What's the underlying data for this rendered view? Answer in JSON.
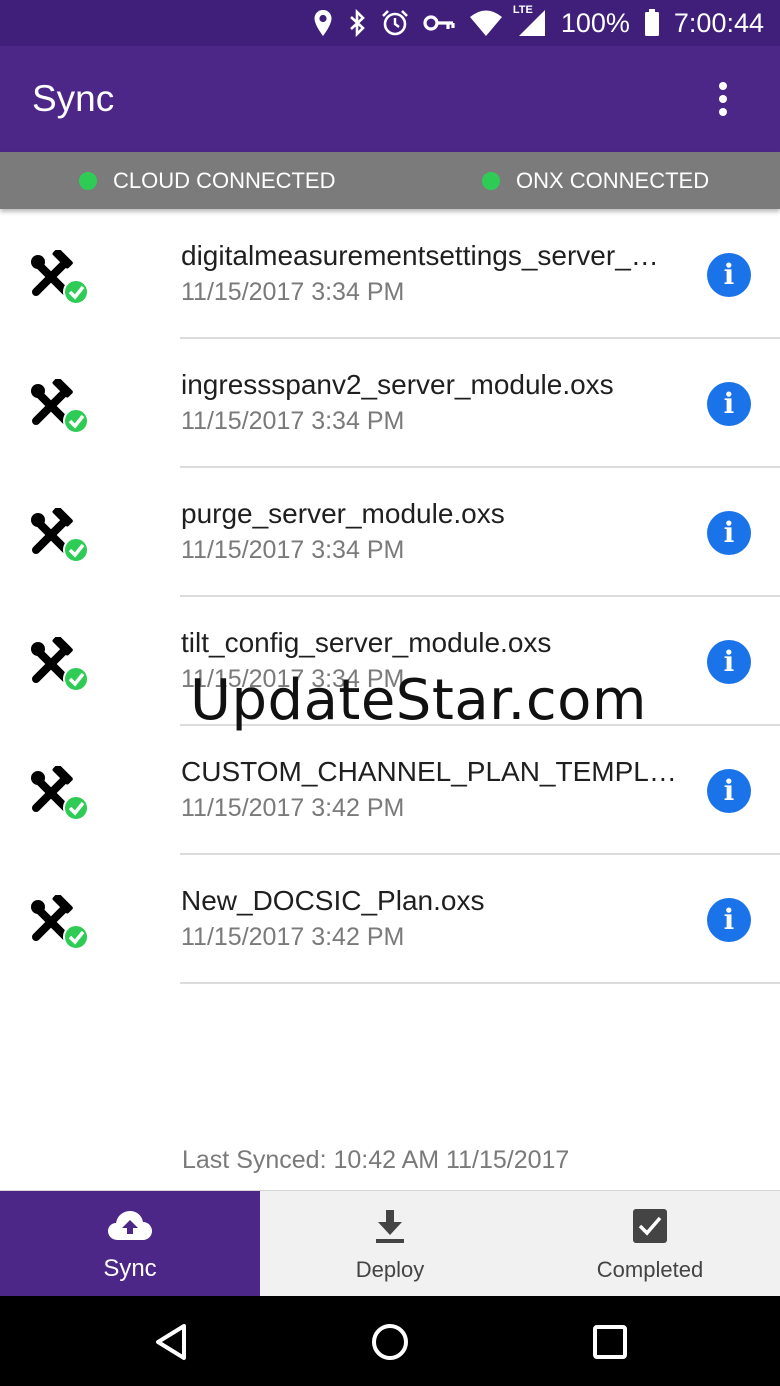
{
  "status_bar": {
    "battery": "100%",
    "time": "7:00:44",
    "network": "LTE",
    "icons": [
      "location-icon",
      "bluetooth-icon",
      "alarm-icon",
      "vpn-key-icon",
      "wifi-icon",
      "signal-icon",
      "battery-icon"
    ]
  },
  "app_bar": {
    "title": "Sync",
    "menu_icon": "more-vert-icon"
  },
  "connection": {
    "cloud_label": "CLOUD CONNECTED",
    "onx_label": "ONX CONNECTED",
    "status_color": "#2ecc55"
  },
  "files": [
    {
      "name": "digitalmeasurementsettings_server_…",
      "date": "11/15/2017 3:34 PM"
    },
    {
      "name": "ingressspanv2_server_module.oxs",
      "date": "11/15/2017 3:34 PM"
    },
    {
      "name": "purge_server_module.oxs",
      "date": "11/15/2017 3:34 PM"
    },
    {
      "name": "tilt_config_server_module.oxs",
      "date": "11/15/2017 3:34 PM"
    },
    {
      "name": "CUSTOM_CHANNEL_PLAN_TEMPL…",
      "date": "11/15/2017 3:42 PM"
    },
    {
      "name": "New_DOCSIC_Plan.oxs",
      "date": "11/15/2017 3:42 PM"
    }
  ],
  "row_icons": {
    "tool": "tools-icon",
    "status": "check-circle-icon",
    "info": "info-icon",
    "info_glyph": "i"
  },
  "watermark": "UpdateStar.com",
  "last_synced": "Last Synced: 10:42 AM 11/15/2017",
  "bottom_nav": {
    "sync": "Sync",
    "deploy": "Deploy",
    "completed": "Completed"
  },
  "colors": {
    "primary": "#4d2787",
    "status_bar": "#3f1f79",
    "info_blue": "#1a73e8",
    "check_green": "#2ecc55"
  }
}
